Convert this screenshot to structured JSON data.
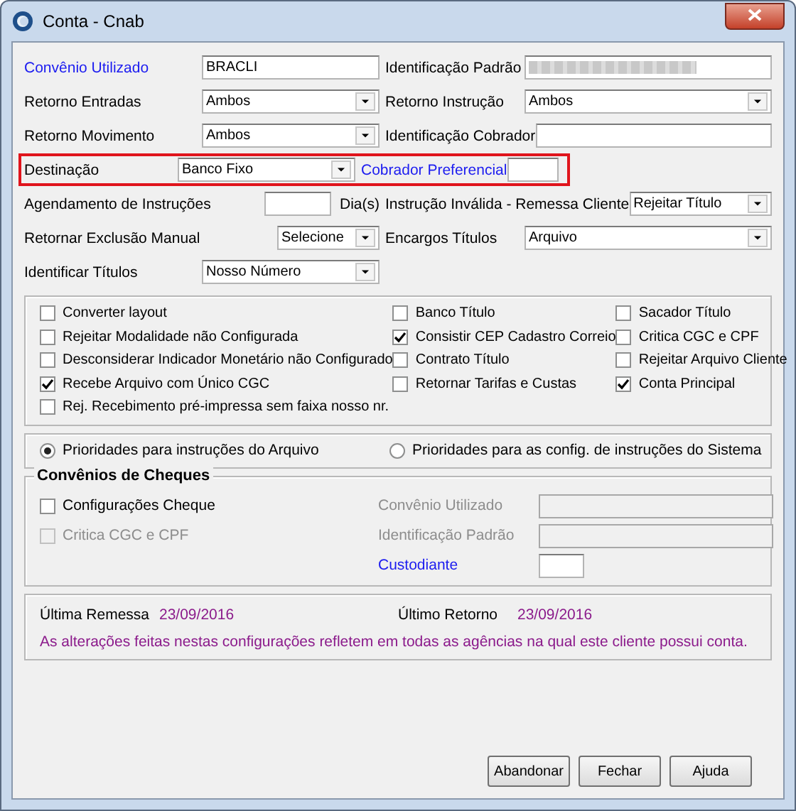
{
  "window": {
    "title": "Conta - Cnab"
  },
  "rows": [
    {
      "highlighted": false,
      "left": {
        "label": "Convênio Utilizado",
        "link": true,
        "kind": "text",
        "value": "BRACLI"
      },
      "right": {
        "label": "Identificação Padrão",
        "link": false,
        "kind": "redacted"
      }
    },
    {
      "highlighted": false,
      "left": {
        "label": "Retorno Entradas",
        "link": false,
        "kind": "select",
        "value": "Ambos"
      },
      "right": {
        "label": "Retorno Instrução",
        "link": false,
        "kind": "select",
        "value": "Ambos"
      }
    },
    {
      "highlighted": false,
      "left": {
        "label": "Retorno Movimento",
        "link": false,
        "kind": "select",
        "value": "Ambos"
      },
      "right": {
        "label": "Identificação Cobrador",
        "link": false,
        "kind": "text"
      }
    },
    {
      "highlighted": true,
      "left": {
        "label": "Destinação",
        "link": false,
        "kind": "select",
        "value": "Banco Fixo"
      },
      "right": {
        "label": "Cobrador Preferencial",
        "link": true,
        "kind": "short-text"
      }
    },
    {
      "highlighted": false,
      "left": {
        "label": "Agendamento de Instruções",
        "link": false,
        "kind": "days",
        "suffix": "Dia(s)"
      },
      "right": {
        "label": "Instrução Inválida - Remessa Cliente",
        "link": false,
        "kind": "select",
        "value": "Rejeitar Título"
      }
    },
    {
      "highlighted": false,
      "left": {
        "label": "Retornar Exclusão Manual",
        "link": false,
        "kind": "short-select",
        "value": "Selecione"
      },
      "right": {
        "label": "Encargos Títulos",
        "link": false,
        "kind": "short-select",
        "value": "Arquivo"
      }
    },
    {
      "highlighted": false,
      "left": {
        "label": "Identificar Títulos",
        "link": false,
        "kind": "select",
        "value": "Nosso Número"
      }
    }
  ],
  "options": [
    [
      {
        "label": "Converter layout",
        "checked": false
      },
      {
        "label": "Rejeitar Modalidade não Configurada",
        "checked": false
      },
      {
        "label": "Desconsiderar Indicador Monetário não Configurado",
        "checked": false
      },
      {
        "label": "Recebe Arquivo com Único CGC",
        "checked": true
      },
      {
        "label": "Rej. Recebimento pré-impressa sem faixa nosso nr.",
        "checked": false
      }
    ],
    [
      {
        "label": "Banco Título",
        "checked": false
      },
      {
        "label": "Consistir CEP Cadastro Correio",
        "checked": true
      },
      {
        "label": "Contrato Título",
        "checked": false
      },
      {
        "label": "Retornar Tarifas e Custas",
        "checked": false
      }
    ],
    [
      {
        "label": "Sacador Título",
        "checked": false
      },
      {
        "label": "Critica CGC e CPF",
        "checked": false
      },
      {
        "label": "Rejeitar Arquivo Cliente",
        "checked": false
      },
      {
        "label": "Conta Principal",
        "checked": true
      }
    ]
  ],
  "priorities": [
    {
      "label": "Prioridades para instruções do Arquivo",
      "selected": true
    },
    {
      "label": "Prioridades para as config. de instruções do Sistema",
      "selected": false
    }
  ],
  "cheques": {
    "title": "Convênios de Cheques",
    "checks": [
      {
        "label": "Configurações Cheque",
        "checked": false,
        "disabled": false
      },
      {
        "label": "Critica CGC e CPF",
        "checked": false,
        "disabled": true
      }
    ],
    "fields": [
      {
        "label": "Convênio Utilizado",
        "disabled": true,
        "link": false,
        "kind": "text"
      },
      {
        "label": "Identificação Padrão",
        "disabled": true,
        "link": false,
        "kind": "text"
      },
      {
        "label": "Custodiante",
        "disabled": false,
        "link": true,
        "kind": "short-text"
      }
    ]
  },
  "info": {
    "last_sent_label": "Última Remessa",
    "last_sent": "23/09/2016",
    "last_return_label": "Último Retorno",
    "last_return": "23/09/2016",
    "note": "As alterações feitas nestas configurações refletem em todas as agências na qual este cliente possui conta."
  },
  "buttons": [
    "Abandonar",
    "Fechar",
    "Ajuda"
  ]
}
